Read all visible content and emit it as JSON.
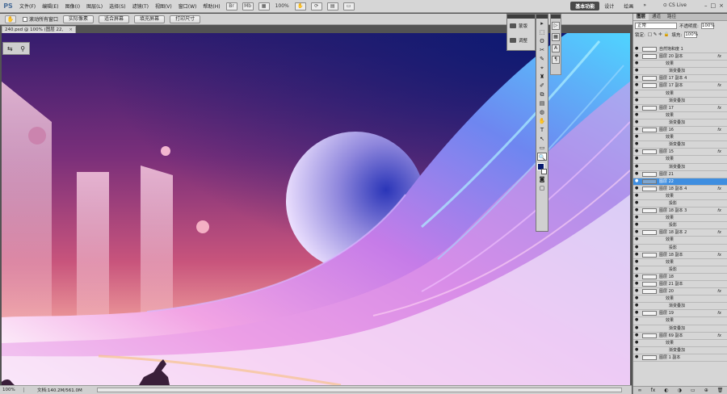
{
  "app": {
    "logo": "PS",
    "workspace_active": "基本功能",
    "workspaces": [
      "设计",
      "绘画"
    ],
    "more": "»",
    "cs_live": "CS Live",
    "window_controls": [
      "–",
      "□",
      "×"
    ]
  },
  "menu": [
    "文件(F)",
    "编辑(E)",
    "图像(I)",
    "图层(L)",
    "选择(S)",
    "滤镜(T)",
    "视图(V)",
    "窗口(W)",
    "帮助(H)"
  ],
  "menubar_zoom": "100%",
  "options": {
    "scroll_all": "滚动所有窗口",
    "buttons": [
      "实际像素",
      "适合屏幕",
      "填充屏幕",
      "打印尺寸"
    ]
  },
  "document": {
    "tab_title": "240.psd @ 100% (图层 22, RGB/8)",
    "close": "×"
  },
  "status": {
    "zoom": "100%",
    "info": "文档:140.2M/561.0M"
  },
  "adjust_panel": {
    "items": [
      "蒙版",
      "调整"
    ]
  },
  "toolbox": {
    "tools": [
      "▸",
      "⬚",
      "ʘ",
      "✂",
      "✎",
      "⌖",
      "♜",
      "✐",
      "⧉",
      "▤",
      "◍",
      "✋",
      "T",
      "↖",
      "▭",
      "🔍"
    ],
    "fg_color": "#081a6e",
    "bg_color": "#ffffff"
  },
  "layers_panel": {
    "tabs": [
      "图层",
      "通道",
      "路径"
    ],
    "blend_mode": "正常",
    "opacity_label": "不透明度:",
    "opacity": "100%",
    "lock_label": "锁定:",
    "fill_label": "填充:",
    "fill": "100%",
    "layers": [
      {
        "name": "自然饱和度 1",
        "type": "adj",
        "fx": ""
      },
      {
        "name": "图层 20 副本",
        "type": "layer",
        "fx": "fx"
      },
      {
        "name": "效果",
        "type": "sub",
        "fx": ""
      },
      {
        "name": "渐变叠加",
        "type": "sub2",
        "fx": ""
      },
      {
        "name": "图层 17 副本 4",
        "type": "layer",
        "fx": ""
      },
      {
        "name": "图层 17 副本",
        "type": "layer",
        "fx": "fx"
      },
      {
        "name": "效果",
        "type": "sub",
        "fx": ""
      },
      {
        "name": "渐变叠加",
        "type": "sub2",
        "fx": ""
      },
      {
        "name": "图层 17",
        "type": "layer",
        "fx": "fx"
      },
      {
        "name": "效果",
        "type": "sub",
        "fx": ""
      },
      {
        "name": "渐变叠加",
        "type": "sub2",
        "fx": ""
      },
      {
        "name": "图层 16",
        "type": "layer",
        "fx": "fx"
      },
      {
        "name": "效果",
        "type": "sub",
        "fx": ""
      },
      {
        "name": "渐变叠加",
        "type": "sub2",
        "fx": ""
      },
      {
        "name": "图层 15",
        "type": "layer",
        "fx": "fx"
      },
      {
        "name": "效果",
        "type": "sub",
        "fx": ""
      },
      {
        "name": "渐变叠加",
        "type": "sub2",
        "fx": ""
      },
      {
        "name": "图层 21",
        "type": "layer",
        "fx": ""
      },
      {
        "name": "图层 22",
        "type": "selected",
        "fx": ""
      },
      {
        "name": "图层 18 副本 4",
        "type": "layer",
        "fx": "fx"
      },
      {
        "name": "效果",
        "type": "sub",
        "fx": ""
      },
      {
        "name": "投影",
        "type": "sub2",
        "fx": ""
      },
      {
        "name": "图层 18 副本 3",
        "type": "layer",
        "fx": "fx"
      },
      {
        "name": "效果",
        "type": "sub",
        "fx": ""
      },
      {
        "name": "投影",
        "type": "sub2",
        "fx": ""
      },
      {
        "name": "图层 18 副本 2",
        "type": "layer",
        "fx": "fx"
      },
      {
        "name": "效果",
        "type": "sub",
        "fx": ""
      },
      {
        "name": "投影",
        "type": "sub2",
        "fx": ""
      },
      {
        "name": "图层 18 副本",
        "type": "layer",
        "fx": "fx"
      },
      {
        "name": "效果",
        "type": "sub",
        "fx": ""
      },
      {
        "name": "投影",
        "type": "sub2",
        "fx": ""
      },
      {
        "name": "图层 18",
        "type": "layer",
        "fx": ""
      },
      {
        "name": "图层 21 副本",
        "type": "layer",
        "fx": ""
      },
      {
        "name": "图层 20",
        "type": "layer",
        "fx": "fx"
      },
      {
        "name": "效果",
        "type": "sub",
        "fx": ""
      },
      {
        "name": "渐变叠加",
        "type": "sub2",
        "fx": ""
      },
      {
        "name": "图层 19",
        "type": "layer",
        "fx": "fx"
      },
      {
        "name": "效果",
        "type": "sub",
        "fx": ""
      },
      {
        "name": "渐变叠加",
        "type": "sub2",
        "fx": ""
      },
      {
        "name": "图层 69 副本",
        "type": "layer",
        "fx": "fx"
      },
      {
        "name": "效果",
        "type": "sub",
        "fx": ""
      },
      {
        "name": "渐变叠加",
        "type": "sub2",
        "fx": ""
      },
      {
        "name": "图层 1 副本",
        "type": "layer",
        "fx": ""
      }
    ],
    "footer_icons": [
      "∞",
      "fx",
      "◐",
      "◑",
      "▭",
      "⊕",
      "🗑"
    ]
  }
}
